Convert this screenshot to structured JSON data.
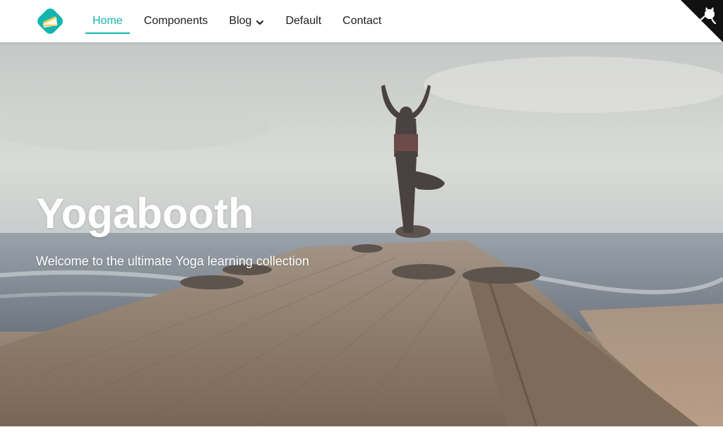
{
  "nav": {
    "items": [
      {
        "label": "Home",
        "active": true
      },
      {
        "label": "Components",
        "active": false
      },
      {
        "label": "Blog",
        "active": false,
        "dropdown": true
      },
      {
        "label": "Default",
        "active": false
      },
      {
        "label": "Contact",
        "active": false
      }
    ],
    "logo_icon": "cake-slice-icon",
    "corner_icon": "github-octocat-icon"
  },
  "hero": {
    "title": "Yogabooth",
    "subtitle": "Welcome to the ultimate Yoga learning collection"
  },
  "colors": {
    "accent": "#13b5b0",
    "nav_text": "#1d1d1d",
    "corner": "#111111"
  }
}
